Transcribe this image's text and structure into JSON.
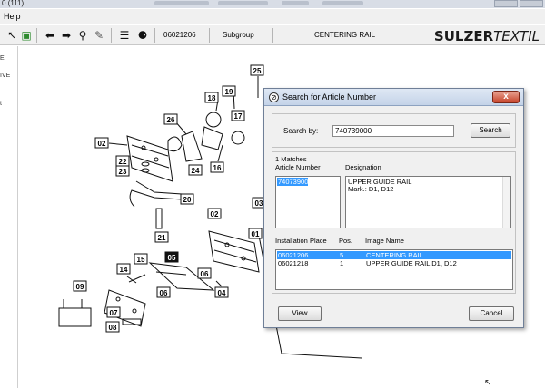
{
  "window": {
    "title": "0 (111)"
  },
  "menu": {
    "help": "Help"
  },
  "toolbar": {
    "icons": [
      "view-icon",
      "book-icon",
      "back-arrow-icon",
      "forward-arrow-icon",
      "zoom-icon",
      "tools-icon",
      "list-icon",
      "binoculars-icon"
    ],
    "drawing_number": "06021206",
    "subgroup_label": "Subgroup",
    "subgroup_name": "CENTERING RAIL",
    "brand_bold": "SULZER",
    "brand_thin": "TEXTIL"
  },
  "left_panel": {
    "items": [
      "E",
      "IVE",
      "t"
    ]
  },
  "drawing": {
    "part_labels": [
      "25",
      "19",
      "18",
      "17",
      "26",
      "02",
      "22",
      "23",
      "24",
      "16",
      "20",
      "21",
      "02",
      "03",
      "01",
      "15",
      "05",
      "14",
      "06",
      "06",
      "04",
      "09",
      "07",
      "08"
    ]
  },
  "dialog": {
    "title": "Search for Article Number",
    "close_label": "x",
    "search_by_label": "Search by:",
    "search_value": "740739000",
    "search_button": "Search",
    "matches_label": "1 Matches",
    "article_number_header": "Article Number",
    "designation_header": "Designation",
    "articles": [
      "740739000"
    ],
    "designation_line1": "UPPER GUIDE RAIL",
    "designation_line2": "Mark.: D1, D12",
    "installation_header": "Installation Place",
    "pos_header": "Pos.",
    "image_name_header": "Image Name",
    "installation_rows": [
      {
        "place": "06021206",
        "pos": "5",
        "image": "CENTERING RAIL"
      },
      {
        "place": "06021218",
        "pos": "1",
        "image": "UPPER GUIDE RAIL D1, D12"
      }
    ],
    "view_button": "View",
    "cancel_button": "Cancel"
  }
}
